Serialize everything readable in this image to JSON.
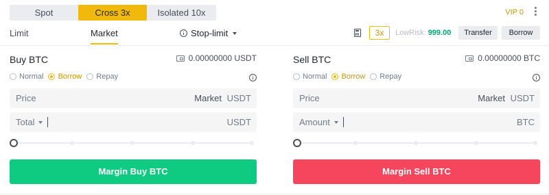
{
  "mode_tabs": [
    "Spot",
    "Cross 3x",
    "Isolated 10x"
  ],
  "vip": "VIP 0",
  "order_types": {
    "limit": "Limit",
    "market": "Market",
    "stop_limit": "Stop-limit"
  },
  "leverage_badge": "3x",
  "risk": {
    "label": "LowRisk:",
    "value": "999.00"
  },
  "buttons": {
    "transfer": "Transfer",
    "borrow": "Borrow"
  },
  "modes": [
    "Normal",
    "Borrow",
    "Repay"
  ],
  "buy": {
    "title": "Buy BTC",
    "balance": "0.00000000 USDT",
    "price_label": "Price",
    "price_value": "Market",
    "price_unit": "USDT",
    "total_label": "Total",
    "total_unit": "USDT",
    "action": "Margin Buy BTC"
  },
  "sell": {
    "title": "Sell BTC",
    "balance": "0.00000000 BTC",
    "price_label": "Price",
    "price_value": "Market",
    "price_unit": "USDT",
    "amount_label": "Amount",
    "amount_unit": "BTC",
    "action": "Margin Sell BTC"
  },
  "colors": {
    "accent": "#f0b90b",
    "buy": "#0ecb81",
    "sell": "#f6465d",
    "risk_low": "#03a66d"
  },
  "icons": [
    "info-icon",
    "calculator-icon",
    "wallet-icon",
    "more-vertical-icon",
    "caret-down-icon"
  ]
}
